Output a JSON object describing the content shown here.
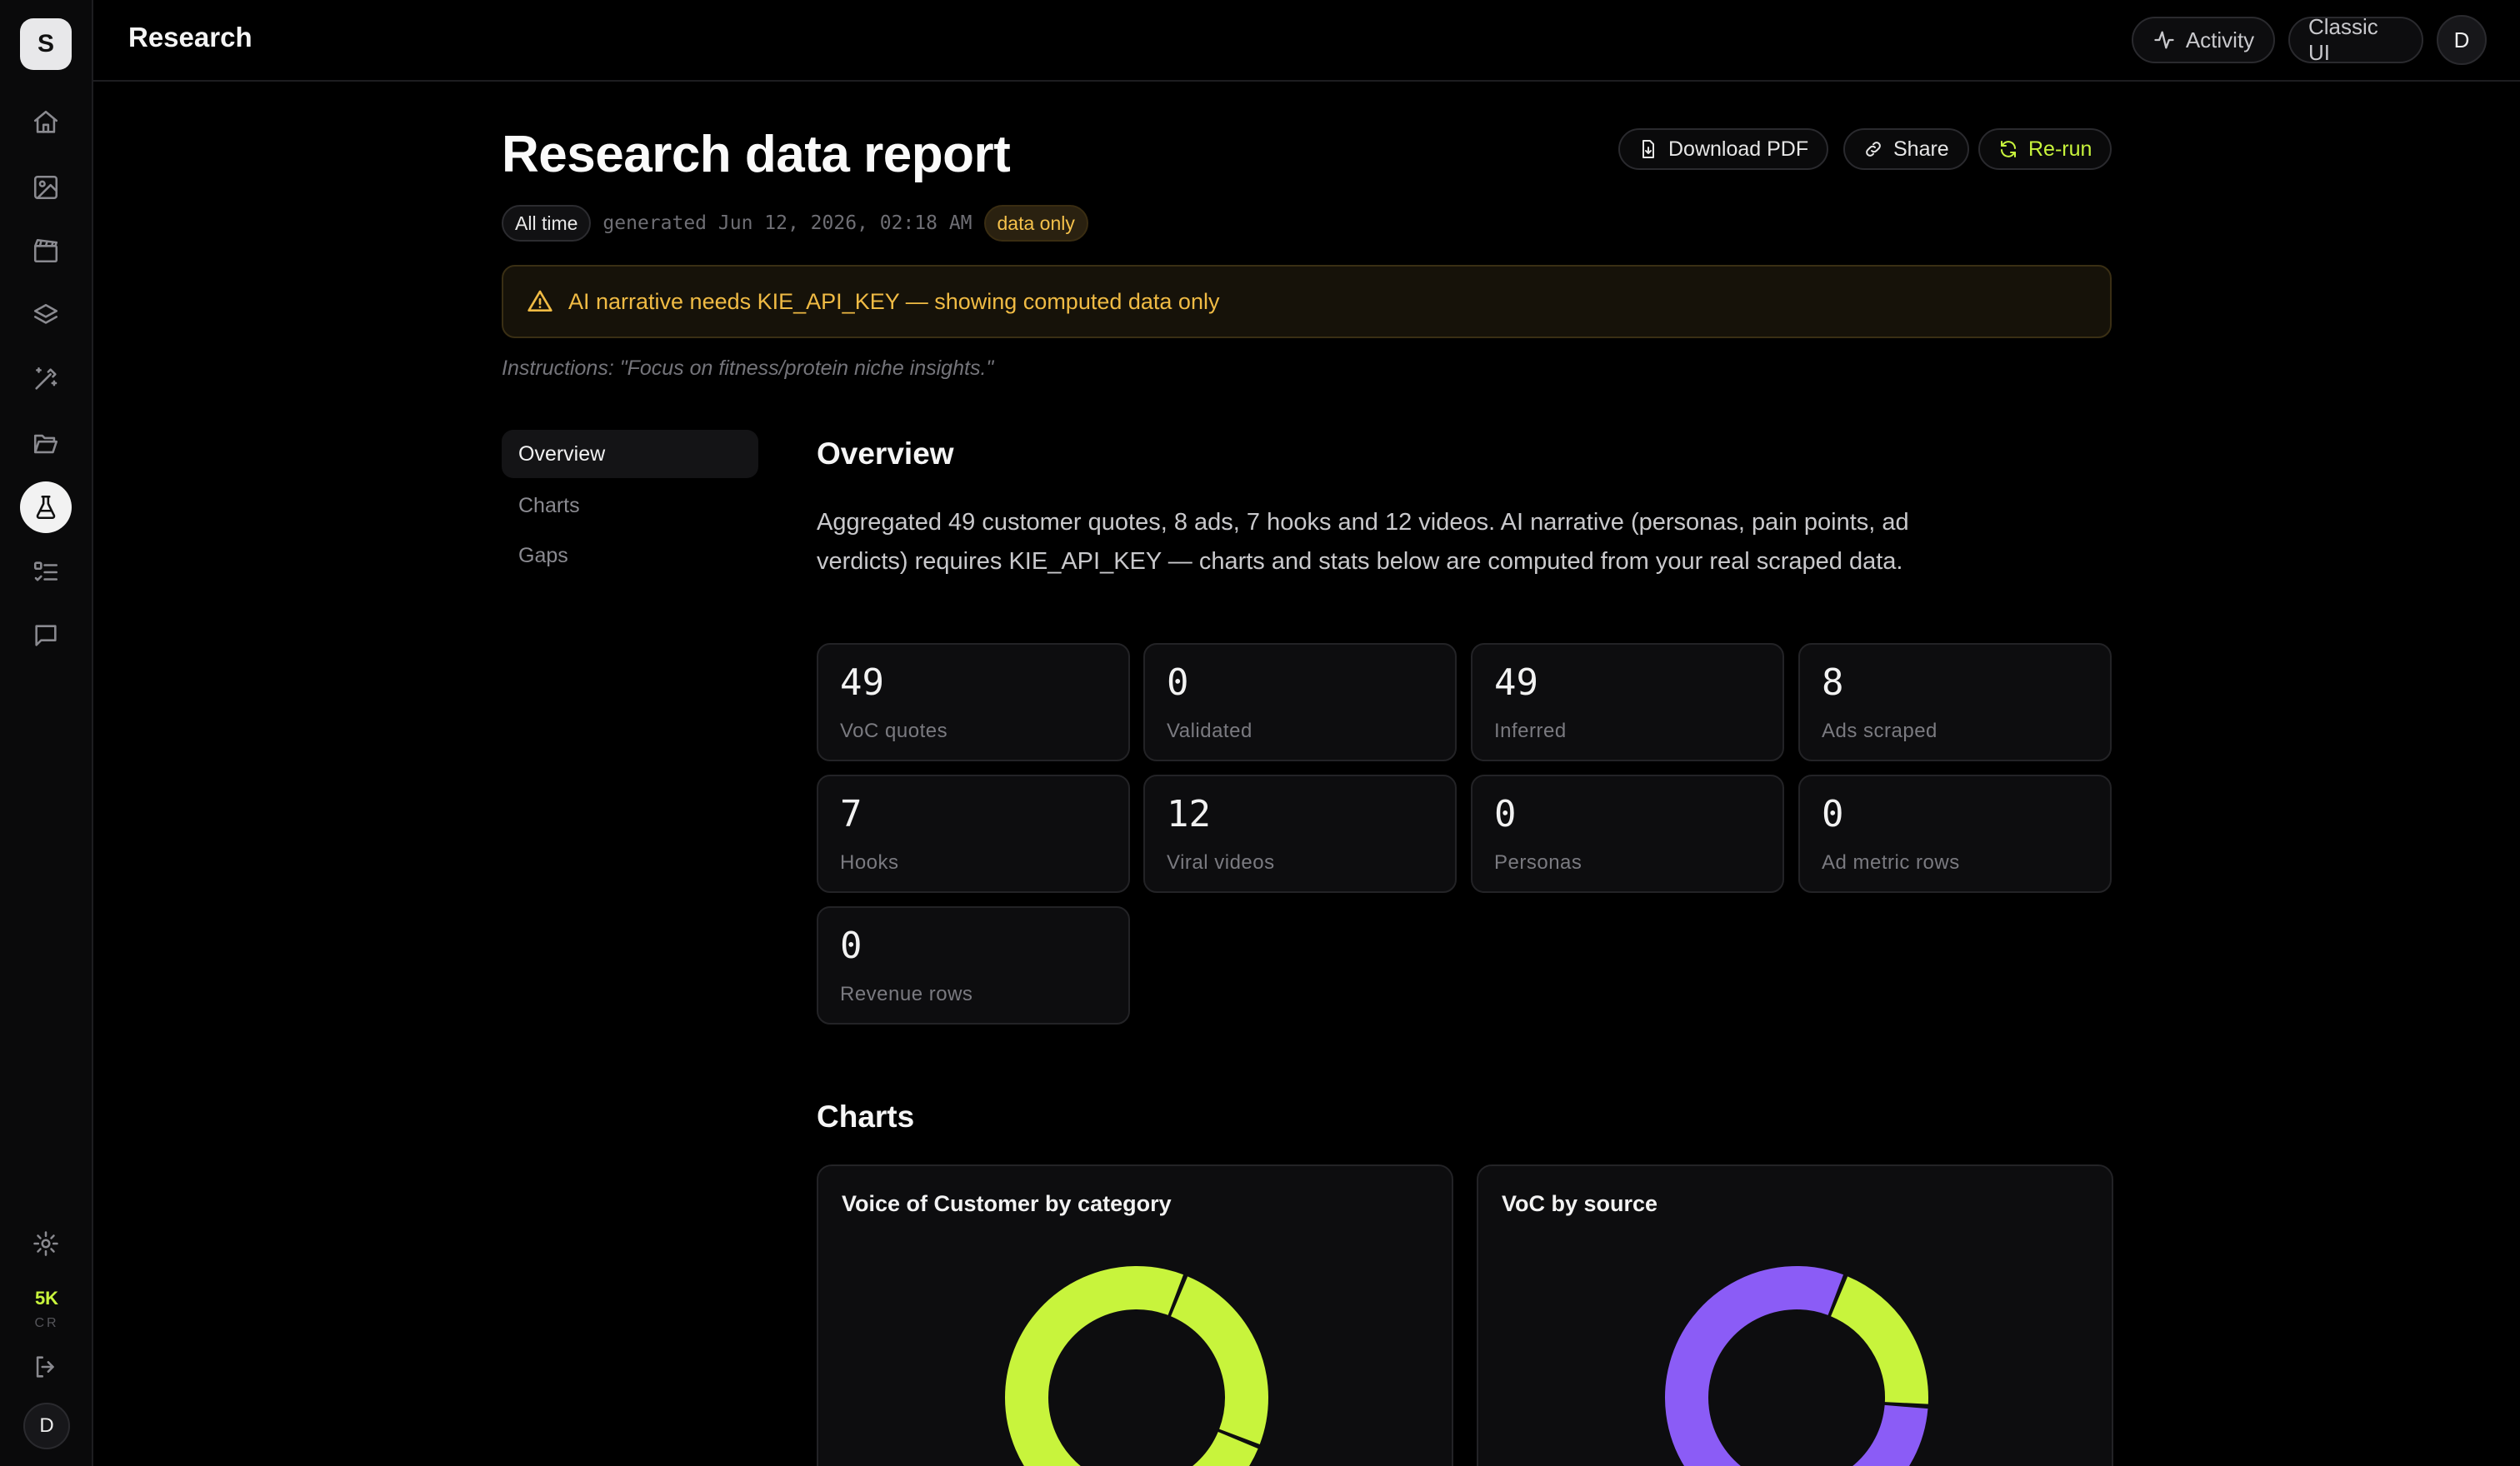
{
  "app": {
    "logo_letter": "S",
    "page_title": "Research",
    "user_initial": "D"
  },
  "sidebar": {
    "items": [
      {
        "name": "home-icon",
        "active": false
      },
      {
        "name": "image-icon",
        "active": false
      },
      {
        "name": "clapperboard-icon",
        "active": false
      },
      {
        "name": "layers-icon",
        "active": false
      },
      {
        "name": "magic-wand-icon",
        "active": false
      },
      {
        "name": "folder-open-icon",
        "active": false
      },
      {
        "name": "flask-icon",
        "active": true
      },
      {
        "name": "checklist-icon",
        "active": false
      },
      {
        "name": "message-icon",
        "active": false
      }
    ],
    "credits_amount": "5K",
    "credits_unit": "CR"
  },
  "topbar": {
    "activity_label": "Activity",
    "classic_label": "Classic UI"
  },
  "report": {
    "title": "Research data report",
    "download_label": "Download PDF",
    "share_label": "Share",
    "rerun_label": "Re-run",
    "range_chip": "All time",
    "generated_text": "generated Jun 12, 2026, 02:18 AM",
    "mode_chip": "data only",
    "banner_text": "AI narrative needs KIE_API_KEY — showing computed data only",
    "instructions": "Instructions: \"Focus on fitness/protein niche insights.\""
  },
  "section_nav": [
    {
      "label": "Overview",
      "active": true
    },
    {
      "label": "Charts",
      "active": false
    },
    {
      "label": "Gaps",
      "active": false
    }
  ],
  "overview": {
    "heading": "Overview",
    "summary": "Aggregated 49 customer quotes, 8 ads, 7 hooks and 12 videos. AI narrative (personas, pain points, ad verdicts) requires KIE_API_KEY — charts and stats below are computed from your real scraped data.",
    "stats": [
      {
        "value": "49",
        "label": "VoC quotes"
      },
      {
        "value": "0",
        "label": "Validated"
      },
      {
        "value": "49",
        "label": "Inferred"
      },
      {
        "value": "8",
        "label": "Ads scraped"
      },
      {
        "value": "7",
        "label": "Hooks"
      },
      {
        "value": "12",
        "label": "Viral videos"
      },
      {
        "value": "0",
        "label": "Personas"
      },
      {
        "value": "0",
        "label": "Ad metric rows"
      },
      {
        "value": "0",
        "label": "Revenue rows"
      }
    ]
  },
  "charts": {
    "heading": "Charts",
    "colors": {
      "lime": "#c8f43c",
      "purple": "#8b5cf6"
    },
    "chart_data": [
      {
        "type": "pie",
        "title": "Voice of Customer by category",
        "values": [
          0.25,
          0.75
        ],
        "colors": [
          "#c8f43c",
          "#c8f43c"
        ]
      },
      {
        "type": "pie",
        "title": "VoC by source",
        "values": [
          0.2,
          0.8
        ],
        "colors": [
          "#c8f43c",
          "#8b5cf6"
        ]
      }
    ]
  }
}
